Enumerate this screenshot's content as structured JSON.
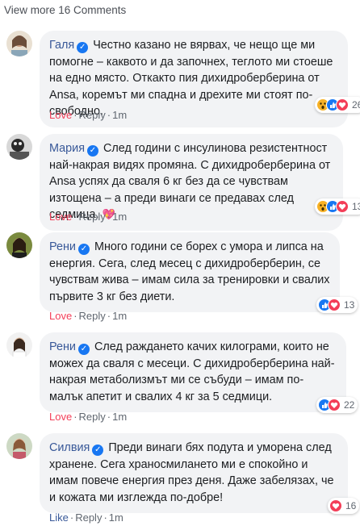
{
  "view_more": "View more 16 Comments",
  "comments": [
    {
      "name": "Галя",
      "text": "Честно казано не вярвах, че нещо ще ми помогне – каквото и да започнех, теглото ми стоеше на едно място. Откакто пия дихидроберберина от Ansa, коремът ми спадна и дрехите ми стоят по-свободно.",
      "first_action": "Love",
      "reply": "Reply",
      "time": "1m",
      "reaction_count": "26",
      "reactions": [
        "wow-icon",
        "like-icon",
        "love-icon"
      ]
    },
    {
      "name": "Мария",
      "text": "След години с инсулинова резистентност най-накрая видях промяна. С дихидроберберина от Ansa успях да сваля 6 кг без да се чувствам изтощена – а преди винаги се предавах след седмица.",
      "emoji": "💖",
      "first_action": "Love",
      "reply": "Reply",
      "time": "1m",
      "reaction_count": "13",
      "reactions": [
        "wow-icon",
        "like-icon",
        "love-icon"
      ]
    },
    {
      "name": "Рени",
      "text": "Много години се борех с умора и липса на енергия. Сега, след месец с дихидроберберин, се чувствам жива – имам сила за тренировки и свалих първите 3 кг без диети.",
      "first_action": "Love",
      "reply": "Reply",
      "time": "1m",
      "reaction_count": "13",
      "reactions": [
        "like-icon",
        "love-icon"
      ]
    },
    {
      "name": "Рени",
      "text": "След раждането качих килограми, които не можех да сваля с месеци. С дихидроберберина най-накрая метаболизмът ми се събуди – имам по-малък апетит и свалих 4 кг за 5 седмици.",
      "first_action": "Love",
      "reply": "Reply",
      "time": "1m",
      "reaction_count": "22",
      "reactions": [
        "like-icon",
        "love-icon"
      ]
    },
    {
      "name": "Силвия",
      "text": "Преди винаги бях подута и уморена след хранене. Сега храносмилането ми е спокойно и имам повече енергия през деня. Даже забелязах, че и кожата ми изглежда по-добре!",
      "first_action": "Like",
      "reply": "Reply",
      "time": "1m",
      "reaction_count": "16",
      "reactions": [
        "love-icon"
      ]
    }
  ],
  "colors": {
    "name_link": "#385898",
    "love_action": "#f33e58",
    "bubble_bg": "#f2f3f5",
    "verified_badge": "#1877f2"
  }
}
